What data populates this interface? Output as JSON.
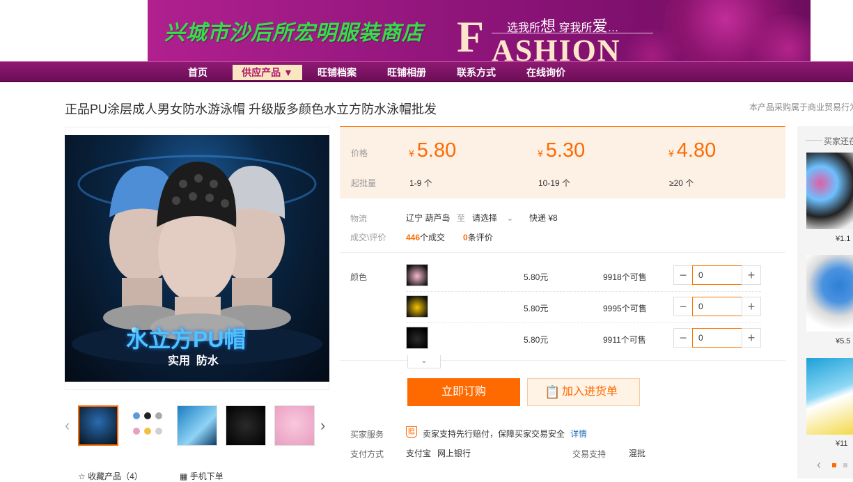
{
  "banner": {
    "shop_name": "兴城市沙后所宏明服装商店",
    "slogan_a": "选我所",
    "slogan_b": "想",
    "slogan_c": " 穿我所",
    "slogan_d": "爱",
    "slogan_e": "…",
    "fashion_first": "F",
    "fashion_rest": "ASHION"
  },
  "nav": {
    "items": [
      {
        "label": "首页"
      },
      {
        "label": "供应产品 ▼"
      },
      {
        "label": "旺铺档案"
      },
      {
        "label": "旺铺相册"
      },
      {
        "label": "联系方式"
      },
      {
        "label": "在线询价"
      }
    ]
  },
  "product": {
    "title": "正品PU涂层成人男女防水游泳帽 升级版多颜色水立方防水泳帽批发",
    "notice": "本产品采购属于商业贸易行为",
    "image_caption_main": "水立方PU帽",
    "image_caption_sub": "实用  防水",
    "favorite_label": "收藏产品（4）",
    "mobile_label": "手机下单"
  },
  "pricing": {
    "price_label": "价格",
    "moq_label": "起批量",
    "currency": "¥",
    "tiers": [
      {
        "price": "5.80",
        "range": "1-9 个"
      },
      {
        "price": "5.30",
        "range": "10-19 个"
      },
      {
        "price": "4.80",
        "range": "≥20 个"
      }
    ]
  },
  "logistics": {
    "label": "物流",
    "origin": "辽宁 葫芦岛",
    "to": "至",
    "destination": "请选择",
    "shipping": "快递 ¥8",
    "deals_label": "成交\\评价",
    "deals_count": "446",
    "deals_unit": "个成交",
    "reviews_count": "0",
    "reviews_unit": "条评价"
  },
  "skus": {
    "label": "颜色",
    "items": [
      {
        "color_name": "pink",
        "price": "5.80元",
        "stock": "9918个可售",
        "qty": "0"
      },
      {
        "color_name": "yellow",
        "price": "5.80元",
        "stock": "9995个可售",
        "qty": "0"
      },
      {
        "color_name": "black",
        "price": "5.80元",
        "stock": "9911个可售",
        "qty": "0"
      }
    ]
  },
  "actions": {
    "buy_now": "立即订购",
    "add_to_cart": "加入进货单"
  },
  "service": {
    "buyer_label": "买家服务",
    "badge": "赔",
    "guarantee": "卖家支持先行赔付，保障买家交易安全",
    "details": "详情",
    "payment_label": "支付方式",
    "payment_a": "支付宝",
    "payment_b": "网上银行",
    "trade_label": "交易支持",
    "trade_value": "混批"
  },
  "side": {
    "heading": "买家还在",
    "prices": [
      "¥1.1",
      "¥5.5",
      "¥11"
    ]
  },
  "colors": {
    "accent": "#ff6a00",
    "nav_bg": "#7d1266",
    "price_bg": "#fdf0e4",
    "shop_name": "#33e04a"
  }
}
